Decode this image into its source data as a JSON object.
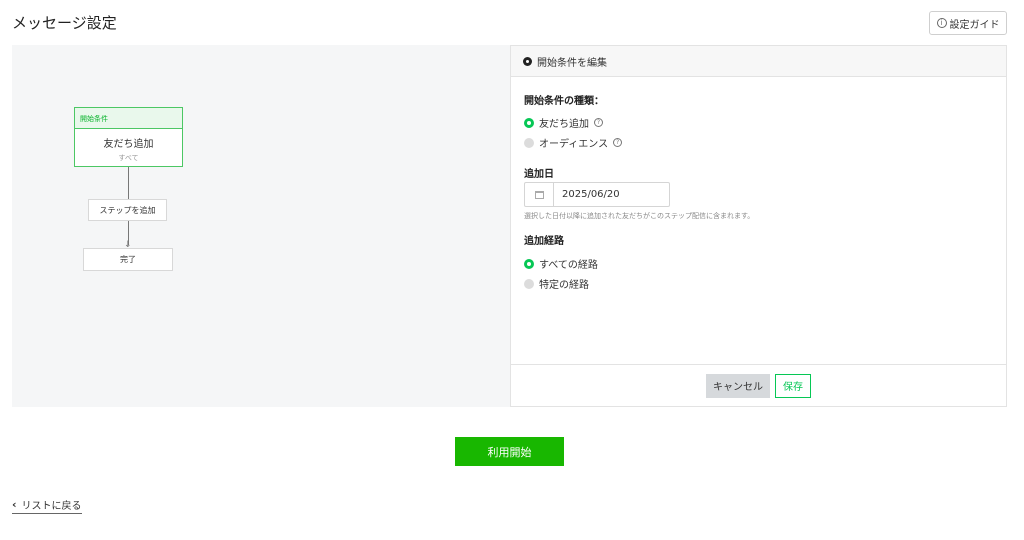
{
  "header": {
    "title": "メッセージ設定",
    "guide_label": "設定ガイド",
    "guide_icon": "info-icon"
  },
  "flow": {
    "start_node": {
      "header": "開始条件",
      "title": "友だち追加",
      "subtitle": "すべて"
    },
    "step_button": "ステップを追加",
    "end_node": "完了"
  },
  "panel": {
    "title": "開始条件を編集",
    "type_label": "開始条件の種類：",
    "type_options": [
      {
        "label": "友だち追加",
        "selected": true
      },
      {
        "label": "オーディエンス",
        "selected": false
      }
    ],
    "date_label": "追加日",
    "date_value": "2025/06/20",
    "date_note": "選択した日付以降に追加された友だちがこのステップ配信に含まれます。",
    "route_label": "追加経路",
    "route_options": [
      {
        "label": "すべての経路",
        "selected": true
      },
      {
        "label": "特定の経路",
        "selected": false
      }
    ],
    "cancel_label": "キャンセル",
    "save_label": "保存"
  },
  "actions": {
    "start_label": "利用開始",
    "back_label": "リストに戻る"
  },
  "colors": {
    "accent_green": "#06c755",
    "start_button": "#18b700",
    "node_border": "#4cc764"
  }
}
